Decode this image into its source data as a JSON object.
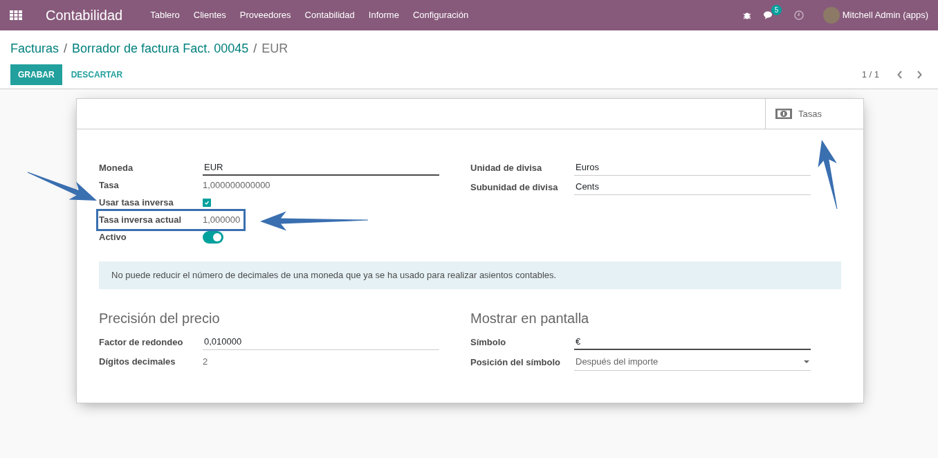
{
  "navbar": {
    "app_title": "Contabilidad",
    "menu": [
      "Tablero",
      "Clientes",
      "Proveedores",
      "Contabilidad",
      "Informe",
      "Configuración"
    ],
    "messages_badge": "5",
    "user": "Mitchell Admin (apps)"
  },
  "breadcrumb_separator": "/",
  "breadcrumbs": [
    {
      "label": "Facturas",
      "current": false
    },
    {
      "label": "Borrador de factura Fact. 00045",
      "current": false
    },
    {
      "label": "EUR",
      "current": true
    }
  ],
  "actions": {
    "primary": "GRABAR",
    "secondary": "DESCARTAR",
    "pager": "1 / 1"
  },
  "smart_button": "Tasas",
  "left_fields": [
    {
      "label": "Moneda",
      "kind": "input",
      "value": "EUR",
      "required": true,
      "highlighted": false
    },
    {
      "label": "Tasa",
      "kind": "text",
      "value": "1,000000000000",
      "highlighted": false
    },
    {
      "label": "Usar tasa inversa",
      "kind": "checkbox",
      "checked": true,
      "highlighted": false
    },
    {
      "label": "Tasa inversa actual",
      "kind": "text",
      "value": "1,000000",
      "highlighted": true
    },
    {
      "label": "Activo",
      "kind": "toggle",
      "on": true,
      "highlighted": false
    }
  ],
  "right_fields": [
    {
      "label": "Unidad de divisa",
      "kind": "input",
      "value": "Euros",
      "required": false,
      "highlighted": false
    },
    {
      "label": "Subunidad de divisa",
      "kind": "input",
      "value": "Cents",
      "required": false,
      "highlighted": false
    }
  ],
  "alert": "No puede reducir el número de decimales de una moneda que ya se ha usado para realizar asientos contables.",
  "sections": [
    {
      "title": "Precisión del precio",
      "fields": [
        {
          "label": "Factor de redondeo",
          "kind": "input",
          "value": "0,010000",
          "required": false,
          "highlighted": false
        },
        {
          "label": "Dígitos decimales",
          "kind": "text",
          "value": "2",
          "highlighted": false
        }
      ]
    },
    {
      "title": "Mostrar en pantalla",
      "fields": [
        {
          "label": "Símbolo",
          "kind": "input",
          "value": "€",
          "required": true,
          "highlighted": false
        },
        {
          "label": "Posición del símbolo",
          "kind": "select",
          "value": "Después del importe",
          "highlighted": false
        }
      ]
    }
  ]
}
